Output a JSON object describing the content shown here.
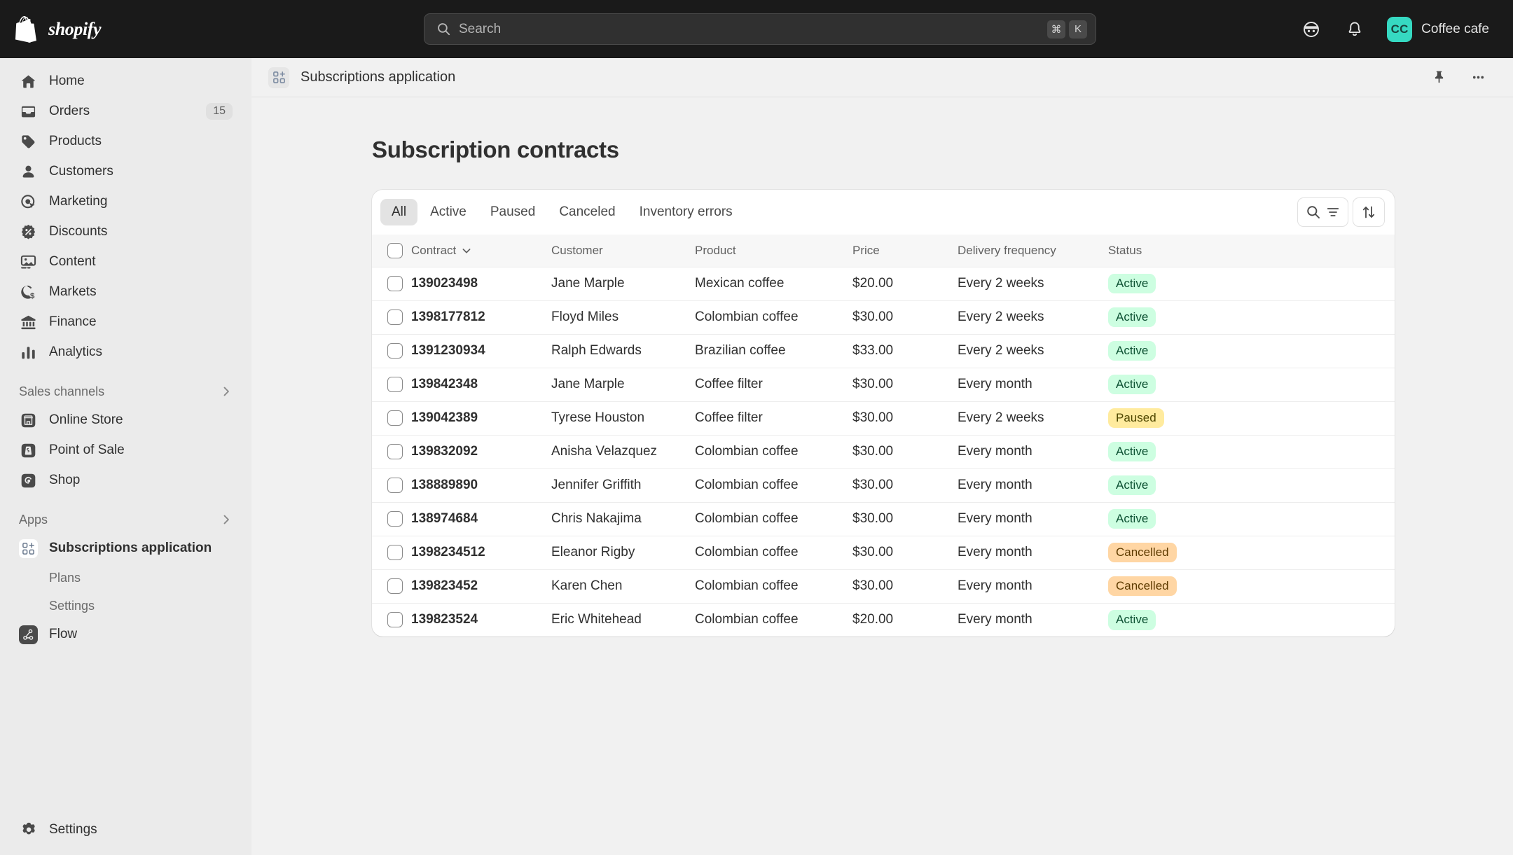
{
  "topbar": {
    "logo_name": "shopify",
    "search": {
      "placeholder": "Search",
      "kbd_cmd": "⌘",
      "kbd_key": "K"
    },
    "store": {
      "initials": "CC",
      "name": "Coffee cafe"
    },
    "accent_teal": "#36d9c2"
  },
  "sidebar": {
    "items": [
      {
        "label": "Home",
        "icon": "home-icon"
      },
      {
        "label": "Orders",
        "icon": "orders-icon",
        "badge": "15"
      },
      {
        "label": "Products",
        "icon": "products-tag-icon"
      },
      {
        "label": "Customers",
        "icon": "customers-person-icon"
      },
      {
        "label": "Marketing",
        "icon": "marketing-target-icon"
      },
      {
        "label": "Discounts",
        "icon": "discounts-badge-icon"
      },
      {
        "label": "Content",
        "icon": "content-image-icon"
      },
      {
        "label": "Markets",
        "icon": "markets-globe-icon"
      },
      {
        "label": "Finance",
        "icon": "finance-bank-icon"
      },
      {
        "label": "Analytics",
        "icon": "analytics-bars-icon"
      }
    ],
    "sales_channels": {
      "title": "Sales channels",
      "items": [
        {
          "label": "Online Store",
          "icon": "online-store-icon"
        },
        {
          "label": "Point of Sale",
          "icon": "point-of-sale-icon"
        },
        {
          "label": "Shop",
          "icon": "shop-icon"
        }
      ]
    },
    "apps": {
      "title": "Apps",
      "items": [
        {
          "label": "Subscriptions application",
          "icon": "subscriptions-app-icon",
          "active": true
        },
        {
          "label": "Flow",
          "icon": "flow-icon"
        }
      ],
      "sub_items": [
        {
          "label": "Plans"
        },
        {
          "label": "Settings"
        }
      ]
    },
    "settings": {
      "label": "Settings",
      "icon": "gear-icon"
    }
  },
  "appbar": {
    "title": "Subscriptions application",
    "icon": "subscriptions-app-icon",
    "pin_label": "pin-icon",
    "more_label": "more-options-icon"
  },
  "page": {
    "title": "Subscription contracts",
    "tabs": [
      {
        "label": "All",
        "selected": true
      },
      {
        "label": "Active",
        "selected": false
      },
      {
        "label": "Paused",
        "selected": false
      },
      {
        "label": "Canceled",
        "selected": false
      },
      {
        "label": "Inventory errors",
        "selected": false
      }
    ],
    "toolbar": {
      "search_filter_label": "search-and-filter-button",
      "sort_label": "sort-button"
    },
    "table": {
      "columns": [
        "Contract",
        "Customer",
        "Product",
        "Price",
        "Delivery frequency",
        "Status"
      ],
      "rows": [
        {
          "contract": "139023498",
          "customer": "Jane Marple",
          "product": "Mexican coffee",
          "price": "$20.00",
          "frequency": "Every 2 weeks",
          "status": "Active",
          "status_kind": "active"
        },
        {
          "contract": "1398177812",
          "customer": "Floyd Miles",
          "product": "Colombian coffee",
          "price": "$30.00",
          "frequency": "Every 2 weeks",
          "status": "Active",
          "status_kind": "active"
        },
        {
          "contract": "1391230934",
          "customer": "Ralph Edwards",
          "product": "Brazilian coffee",
          "price": "$33.00",
          "frequency": "Every 2 weeks",
          "status": "Active",
          "status_kind": "active"
        },
        {
          "contract": "139842348",
          "customer": "Jane Marple",
          "product": "Coffee filter",
          "price": "$30.00",
          "frequency": "Every month",
          "status": "Active",
          "status_kind": "active"
        },
        {
          "contract": "139042389",
          "customer": "Tyrese Houston",
          "product": "Coffee filter",
          "price": "$30.00",
          "frequency": "Every 2 weeks",
          "status": "Paused",
          "status_kind": "paused"
        },
        {
          "contract": "139832092",
          "customer": "Anisha Velazquez",
          "product": "Colombian coffee",
          "price": "$30.00",
          "frequency": "Every month",
          "status": "Active",
          "status_kind": "active"
        },
        {
          "contract": "138889890",
          "customer": "Jennifer Griffith",
          "product": "Colombian coffee",
          "price": "$30.00",
          "frequency": "Every month",
          "status": "Active",
          "status_kind": "active"
        },
        {
          "contract": "138974684",
          "customer": "Chris Nakajima",
          "product": "Colombian coffee",
          "price": "$30.00",
          "frequency": "Every month",
          "status": "Active",
          "status_kind": "active"
        },
        {
          "contract": "1398234512",
          "customer": "Eleanor Rigby",
          "product": "Colombian coffee",
          "price": "$30.00",
          "frequency": "Every month",
          "status": "Cancelled",
          "status_kind": "cancelled"
        },
        {
          "contract": "139823452",
          "customer": "Karen Chen",
          "product": "Colombian coffee",
          "price": "$30.00",
          "frequency": "Every month",
          "status": "Cancelled",
          "status_kind": "cancelled"
        },
        {
          "contract": "139823524",
          "customer": "Eric Whitehead",
          "product": "Colombian coffee",
          "price": "$20.00",
          "frequency": "Every month",
          "status": "Active",
          "status_kind": "active"
        }
      ]
    }
  },
  "colors": {
    "status_active_bg": "#cdfee1",
    "status_paused_bg": "#ffeb9e",
    "status_cancelled_bg": "#ffd6a4"
  }
}
